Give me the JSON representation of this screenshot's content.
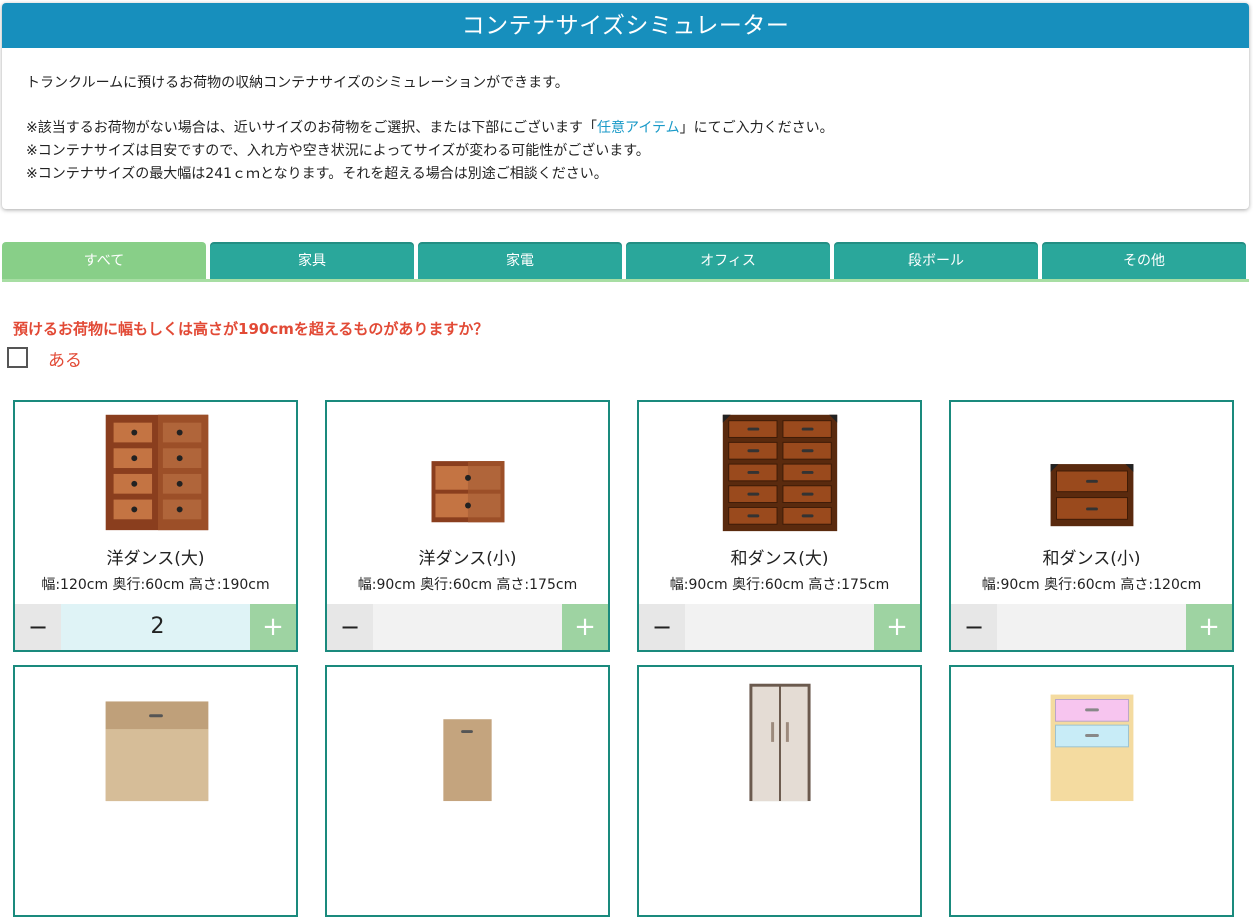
{
  "header": {
    "title": "コンテナサイズシミュレーター",
    "intro": "トランクルームに預けるお荷物の収納コンテナサイズのシミュレーションができます。",
    "note1_pre": "※該当するお荷物がない場合は、近いサイズのお荷物をご選択、または下部にございます「",
    "note1_link": "任意アイテム",
    "note1_post": "」にてご入力ください。",
    "note2": "※コンテナサイズは目安ですので、入れ方や空き状況によってサイズが変わる可能性がございます。",
    "note3": "※コンテナサイズの最大幅は241ｃｍとなります。それを超える場合は別途ご相談ください。"
  },
  "tabs": [
    {
      "label": "すべて",
      "active": true
    },
    {
      "label": "家具",
      "active": false
    },
    {
      "label": "家電",
      "active": false
    },
    {
      "label": "オフィス",
      "active": false
    },
    {
      "label": "段ボール",
      "active": false
    },
    {
      "label": "その他",
      "active": false
    }
  ],
  "question": {
    "text": "預けるお荷物に幅もしくは高さが190cmを超えるものがありますか？",
    "checkbox_label": "ある",
    "checked": false
  },
  "items": [
    {
      "name": "洋ダンス(大)",
      "dims": "幅:120cm 奥行:60cm 高さ:190cm",
      "qty": "2",
      "icon": "large-western-dresser-icon"
    },
    {
      "name": "洋ダンス(小)",
      "dims": "幅:90cm 奥行:60cm 高さ:175cm",
      "qty": "",
      "icon": "small-western-dresser-icon"
    },
    {
      "name": "和ダンス(大)",
      "dims": "幅:90cm 奥行:60cm 高さ:175cm",
      "qty": "",
      "icon": "large-japanese-chest-icon"
    },
    {
      "name": "和ダンス(小)",
      "dims": "幅:90cm 奥行:60cm 高さ:120cm",
      "qty": "",
      "icon": "small-japanese-chest-icon"
    }
  ],
  "stepper": {
    "minus": "−",
    "plus": "+"
  },
  "colors": {
    "title_bar": "#178fbd",
    "tab": "#2aa79b",
    "tab_active": "#88cf88",
    "question": "#e24a36",
    "card_border": "#1a8a7d",
    "plus_button": "#9ed3a2"
  }
}
